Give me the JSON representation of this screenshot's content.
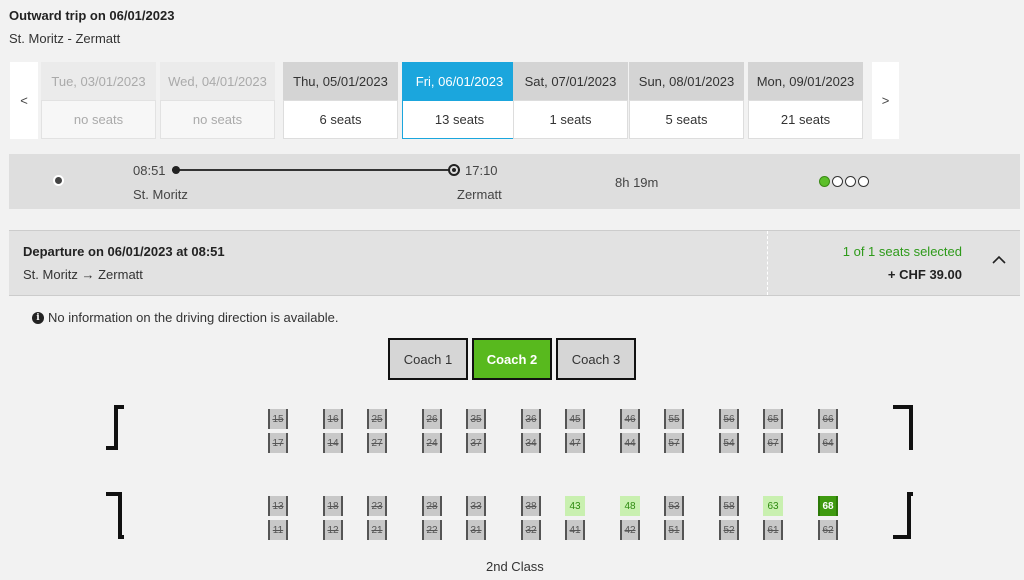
{
  "trip": {
    "title": "Outward trip on 06/01/2023",
    "route": "St. Moritz - Zermatt"
  },
  "date_nav": {
    "prev": "<",
    "next": ">"
  },
  "days": [
    {
      "date": "Tue, 03/01/2023",
      "seats": "no seats",
      "state": "disabled"
    },
    {
      "date": "Wed, 04/01/2023",
      "seats": "no seats",
      "state": "disabled"
    },
    {
      "date": "Thu, 05/01/2023",
      "seats": "6 seats",
      "state": "normal"
    },
    {
      "date": "Fri, 06/01/2023",
      "seats": "13 seats",
      "state": "active"
    },
    {
      "date": "Sat, 07/01/2023",
      "seats": "1 seats",
      "state": "normal"
    },
    {
      "date": "Sun, 08/01/2023",
      "seats": "5 seats",
      "state": "normal"
    },
    {
      "date": "Mon, 09/01/2023",
      "seats": "21 seats",
      "state": "normal"
    }
  ],
  "connection": {
    "dep_time": "08:51",
    "dep_station": "St. Moritz",
    "arr_time": "17:10",
    "arr_station": "Zermatt",
    "duration": "8h 19m",
    "occupancy_filled": 1,
    "occupancy_total": 4
  },
  "departure": {
    "title": "Departure on 06/01/2023 at 08:51",
    "route": "St. Moritz → Zermatt",
    "seats_selected": "1 of 1 seats selected",
    "price": "+ CHF 39.00"
  },
  "info": "No information on the driving direction is available.",
  "coaches": [
    {
      "label": "Coach 1",
      "active": false
    },
    {
      "label": "Coach 2",
      "active": true
    },
    {
      "label": "Coach 3",
      "active": false
    }
  ],
  "seat_rows": [
    {
      "seats": [
        [
          "15",
          "taken"
        ],
        [
          "16",
          "taken"
        ],
        [
          "25",
          "taken"
        ],
        [
          "26",
          "taken"
        ],
        [
          "35",
          "taken"
        ],
        [
          "36",
          "taken"
        ],
        [
          "45",
          "taken"
        ],
        [
          "46",
          "taken"
        ],
        [
          "55",
          "taken"
        ],
        [
          "56",
          "taken"
        ],
        [
          "65",
          "taken"
        ],
        [
          "66",
          "taken"
        ]
      ]
    },
    {
      "seats": [
        [
          "17",
          "taken"
        ],
        [
          "14",
          "taken"
        ],
        [
          "27",
          "taken"
        ],
        [
          "24",
          "taken"
        ],
        [
          "37",
          "taken"
        ],
        [
          "34",
          "taken"
        ],
        [
          "47",
          "taken"
        ],
        [
          "44",
          "taken"
        ],
        [
          "57",
          "taken"
        ],
        [
          "54",
          "taken"
        ],
        [
          "67",
          "taken"
        ],
        [
          "64",
          "taken"
        ]
      ]
    },
    {
      "seats": [
        [
          "13",
          "taken"
        ],
        [
          "18",
          "taken"
        ],
        [
          "23",
          "taken"
        ],
        [
          "28",
          "taken"
        ],
        [
          "33",
          "taken"
        ],
        [
          "38",
          "taken"
        ],
        [
          "43",
          "free"
        ],
        [
          "48",
          "free"
        ],
        [
          "53",
          "taken"
        ],
        [
          "58",
          "taken"
        ],
        [
          "63",
          "free"
        ],
        [
          "68",
          "selected"
        ]
      ]
    },
    {
      "seats": [
        [
          "11",
          "taken"
        ],
        [
          "12",
          "taken"
        ],
        [
          "21",
          "taken"
        ],
        [
          "22",
          "taken"
        ],
        [
          "31",
          "taken"
        ],
        [
          "32",
          "taken"
        ],
        [
          "41",
          "taken"
        ],
        [
          "42",
          "taken"
        ],
        [
          "51",
          "taken"
        ],
        [
          "52",
          "taken"
        ],
        [
          "61",
          "taken"
        ],
        [
          "62",
          "taken"
        ]
      ]
    }
  ],
  "class_label": "2nd Class",
  "colors": {
    "accent": "#1ba6dd",
    "green": "#58b91e",
    "selected_seat": "#3f9a10",
    "free_seat": "#c9f0b0"
  }
}
